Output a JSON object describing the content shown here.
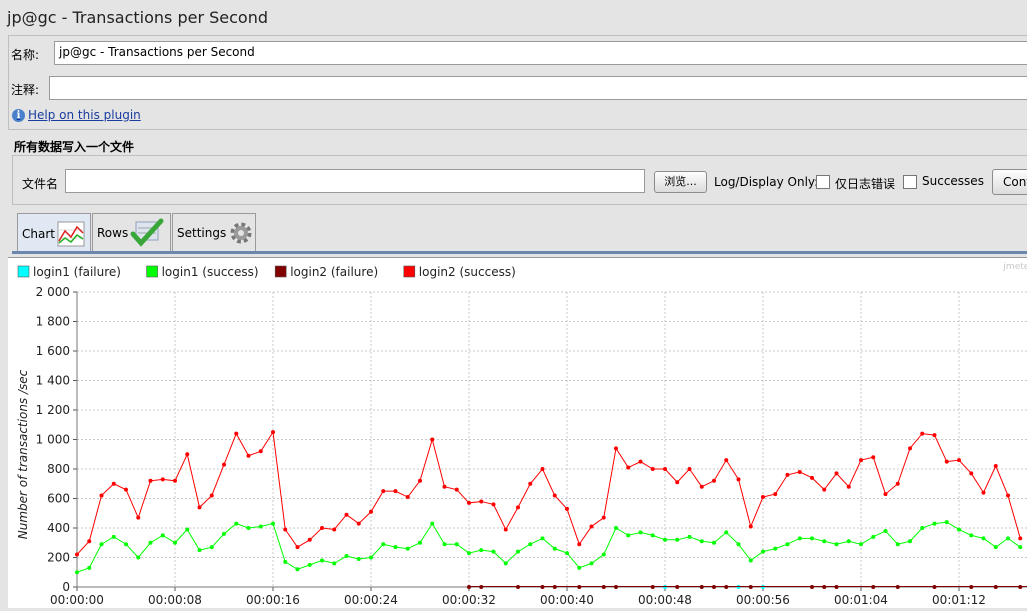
{
  "window": {
    "title": "jp@gc - Transactions per Second"
  },
  "form": {
    "name_label": "名称:",
    "name_value": "jp@gc - Transactions per Second",
    "comment_label": "注释:",
    "comment_value": "",
    "help_link": "Help on this plugin"
  },
  "file_section": {
    "title": "所有数据写入一个文件",
    "filename_label": "文件名",
    "filename_value": "",
    "browse_button": "浏览...",
    "log_display_label": "Log/Display Only:",
    "errors_only_label": "仅日志错误",
    "errors_only_checked": false,
    "successes_label": "Successes",
    "successes_checked": false,
    "configure_button": "Conf"
  },
  "tabs": [
    {
      "label": "Chart",
      "icon": "chart-icon",
      "active": true
    },
    {
      "label": "Rows",
      "icon": "check-icon",
      "active": false
    },
    {
      "label": "Settings",
      "icon": "gear-icon",
      "active": false
    }
  ],
  "watermark": "jmeter",
  "colors": {
    "login1_failure": "#00ffff",
    "login1_success": "#00ff00",
    "login2_failure": "#800000",
    "login2_success": "#ff0000"
  },
  "chart_data": {
    "type": "line",
    "ylabel": "Number of transactions /sec",
    "ylim": [
      0,
      2000
    ],
    "yticks": [
      "0",
      "200",
      "400",
      "600",
      "800",
      "1 000",
      "1 200",
      "1 400",
      "1 600",
      "1 800",
      "2 000"
    ],
    "xticks": [
      "00:00:00",
      "00:00:08",
      "00:00:16",
      "00:00:24",
      "00:00:32",
      "00:00:40",
      "00:00:48",
      "00:00:56",
      "00:01:04",
      "00:01:12"
    ],
    "xlim": [
      0,
      77
    ],
    "grid": true,
    "legend": "top-left",
    "series": [
      {
        "name": "login1 (failure)",
        "color": "#00ffff",
        "x": [
          48,
          51,
          54,
          56
        ],
        "values": [
          0,
          0,
          0,
          0
        ]
      },
      {
        "name": "login1 (success)",
        "color": "#00ff00",
        "x": [
          0,
          1,
          2,
          3,
          4,
          5,
          6,
          7,
          8,
          9,
          10,
          11,
          12,
          13,
          14,
          15,
          16,
          17,
          18,
          19,
          20,
          21,
          22,
          23,
          24,
          25,
          26,
          27,
          28,
          29,
          30,
          31,
          32,
          33,
          34,
          35,
          36,
          37,
          38,
          39,
          40,
          41,
          42,
          43,
          44,
          45,
          46,
          47,
          48,
          49,
          50,
          51,
          52,
          53,
          54,
          55,
          56,
          57,
          58,
          59,
          60,
          61,
          62,
          63,
          64,
          65,
          66,
          67,
          68,
          69,
          70,
          71,
          72,
          73,
          74,
          75,
          76,
          77
        ],
        "values": [
          100,
          130,
          290,
          340,
          290,
          200,
          300,
          350,
          300,
          390,
          250,
          270,
          360,
          430,
          400,
          410,
          430,
          170,
          120,
          150,
          180,
          160,
          210,
          190,
          200,
          290,
          270,
          260,
          300,
          430,
          290,
          290,
          230,
          250,
          240,
          160,
          240,
          290,
          330,
          260,
          230,
          130,
          160,
          220,
          400,
          350,
          370,
          350,
          320,
          320,
          340,
          310,
          300,
          370,
          290,
          180,
          240,
          260,
          290,
          330,
          330,
          310,
          290,
          310,
          290,
          340,
          380,
          290,
          310,
          400,
          430,
          440,
          390,
          350,
          330,
          270,
          330,
          270
        ]
      },
      {
        "name": "login2 (failure)",
        "color": "#800000",
        "x": [
          32,
          33,
          36,
          38,
          39,
          41,
          43,
          44,
          47,
          49,
          51,
          52,
          53,
          55,
          60,
          61,
          62,
          65,
          67,
          70,
          73,
          75,
          77
        ],
        "values": [
          0,
          0,
          0,
          0,
          0,
          0,
          0,
          0,
          0,
          0,
          0,
          0,
          0,
          0,
          0,
          0,
          0,
          0,
          0,
          0,
          0,
          0,
          0
        ]
      },
      {
        "name": "login2 (success)",
        "color": "#ff0000",
        "x": [
          0,
          1,
          2,
          3,
          4,
          5,
          6,
          7,
          8,
          9,
          10,
          11,
          12,
          13,
          14,
          15,
          16,
          17,
          18,
          19,
          20,
          21,
          22,
          23,
          24,
          25,
          26,
          27,
          28,
          29,
          30,
          31,
          32,
          33,
          34,
          35,
          36,
          37,
          38,
          39,
          40,
          41,
          42,
          43,
          44,
          45,
          46,
          47,
          48,
          49,
          50,
          51,
          52,
          53,
          54,
          55,
          56,
          57,
          58,
          59,
          60,
          61,
          62,
          63,
          64,
          65,
          66,
          67,
          68,
          69,
          70,
          71,
          72,
          73,
          74,
          75,
          76,
          77
        ],
        "values": [
          220,
          310,
          620,
          700,
          660,
          470,
          720,
          730,
          720,
          900,
          540,
          620,
          830,
          1040,
          890,
          920,
          1050,
          390,
          270,
          320,
          400,
          390,
          490,
          430,
          510,
          650,
          650,
          610,
          720,
          1000,
          680,
          660,
          570,
          580,
          560,
          390,
          540,
          700,
          800,
          620,
          530,
          290,
          410,
          470,
          940,
          810,
          850,
          800,
          800,
          710,
          800,
          680,
          720,
          860,
          730,
          410,
          610,
          630,
          760,
          780,
          740,
          660,
          770,
          680,
          860,
          880,
          630,
          700,
          940,
          1040,
          1030,
          850,
          860,
          770,
          640,
          820,
          620,
          330
        ]
      }
    ]
  }
}
